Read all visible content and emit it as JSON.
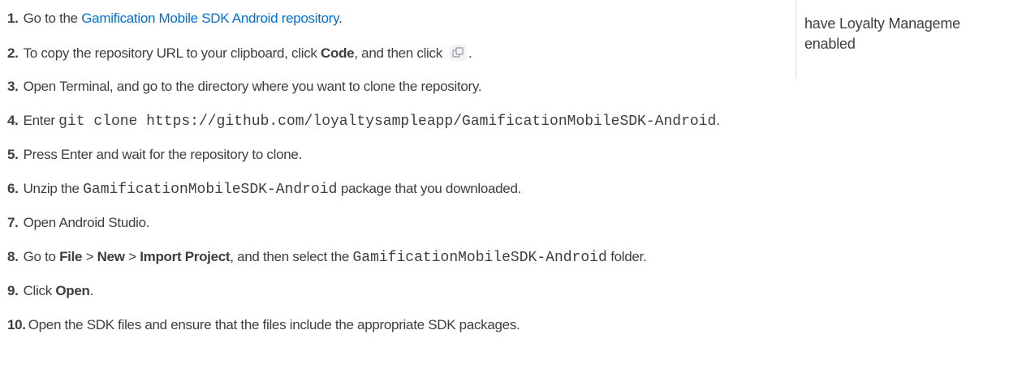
{
  "sidebar": {
    "text_line1": "have Loyalty Manageme",
    "text_line2": "enabled"
  },
  "steps": [
    {
      "num": "1.",
      "pre": "Go to the ",
      "link": "Gamification Mobile SDK Android repository",
      "post": "."
    },
    {
      "num": "2.",
      "pre": "To copy the repository URL to your clipboard, click ",
      "bold": "Code",
      "mid": ", and then click",
      "post": ".",
      "icon": "copy-icon"
    },
    {
      "num": "3.",
      "text": "Open Terminal, and go to the directory where you want to clone the repository."
    },
    {
      "num": "4.",
      "pre": "Enter ",
      "code": "git clone https://github.com/loyaltysampleapp/GamificationMobileSDK-Android",
      "post": "."
    },
    {
      "num": "5.",
      "text": "Press Enter and wait for the repository to clone."
    },
    {
      "num": "6.",
      "pre": "Unzip the ",
      "code": "GamificationMobileSDK-Android",
      "post": " package that you downloaded."
    },
    {
      "num": "7.",
      "text": "Open Android Studio."
    },
    {
      "num": "8.",
      "pre": "Go to ",
      "bold1": "File",
      "sep1": " > ",
      "bold2": "New",
      "sep2": " > ",
      "bold3": "Import Project",
      "mid": ", and then select the ",
      "code": "GamificationMobileSDK-Android",
      "post": " folder."
    },
    {
      "num": "9.",
      "pre": "Click ",
      "bold": "Open",
      "post": "."
    },
    {
      "num": "10.",
      "text": "Open the SDK files and ensure that the files include the appropriate SDK packages."
    }
  ],
  "colors": {
    "link": "#0070d2",
    "text": "#3e3e3c"
  }
}
